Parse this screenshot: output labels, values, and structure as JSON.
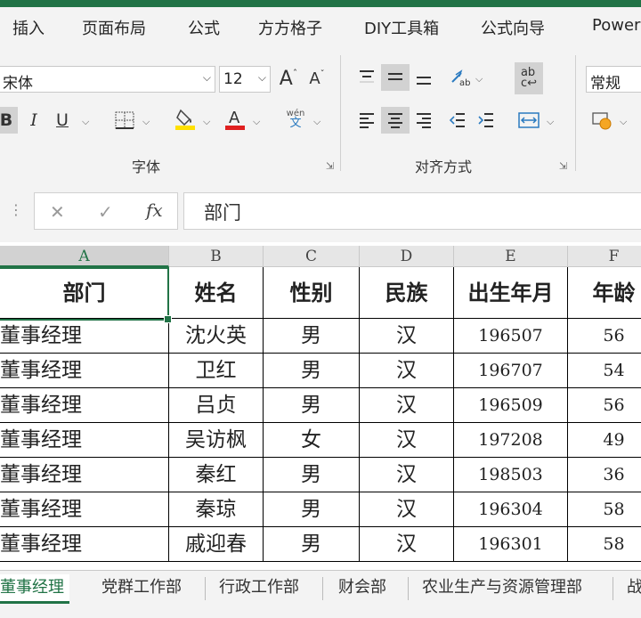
{
  "menu": {
    "tabs": [
      "插入",
      "页面布局",
      "公式",
      "方方格子",
      "DIY工具箱",
      "公式向导",
      "Power"
    ]
  },
  "ribbon": {
    "font_name": "宋体",
    "font_size": "12",
    "grow_font": "A",
    "shrink_font": "A",
    "bold": "B",
    "italic": "I",
    "underline": "U",
    "phonetic_top": "wén",
    "phonetic_bottom": "文",
    "font_group_label": "字体",
    "align_group_label": "对齐方式",
    "wrap_icon_text": "ab",
    "number_format": "常规"
  },
  "formula_bar": {
    "content": "部门",
    "fx": "fx"
  },
  "columns": [
    "A",
    "B",
    "C",
    "D",
    "E",
    "F"
  ],
  "table": {
    "headers": [
      "部门",
      "姓名",
      "性别",
      "民族",
      "出生年月",
      "年龄"
    ],
    "rows": [
      [
        "董事经理",
        "沈火英",
        "男",
        "汉",
        "196507",
        "56"
      ],
      [
        "董事经理",
        "卫红",
        "男",
        "汉",
        "196707",
        "54"
      ],
      [
        "董事经理",
        "吕贞",
        "男",
        "汉",
        "196509",
        "56"
      ],
      [
        "董事经理",
        "吴访枫",
        "女",
        "汉",
        "197208",
        "49"
      ],
      [
        "董事经理",
        "秦红",
        "男",
        "汉",
        "198503",
        "36"
      ],
      [
        "董事经理",
        "秦琼",
        "男",
        "汉",
        "196304",
        "58"
      ],
      [
        "董事经理",
        "戚迎春",
        "男",
        "汉",
        "196301",
        "58"
      ]
    ]
  },
  "sheets": [
    "董事经理",
    "党群工作部",
    "行政工作部",
    "财会部",
    "农业生产与资源管理部",
    "战"
  ],
  "colors": {
    "accent": "#217346",
    "underline_red": "#e02020",
    "highlight_yellow": "#ffe000"
  }
}
